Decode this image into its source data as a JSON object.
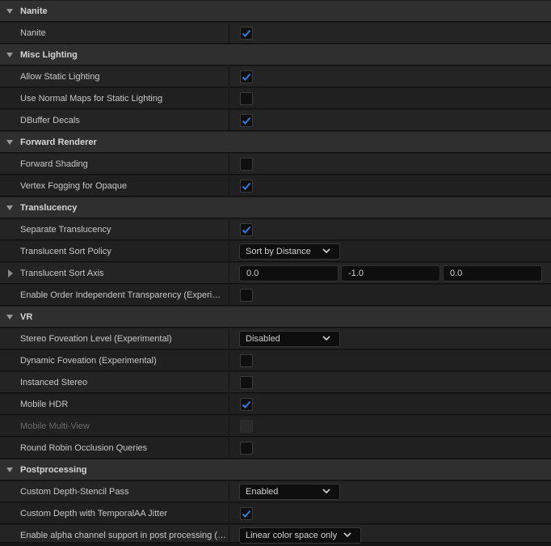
{
  "categories": {
    "nanite": "Nanite",
    "misc_lighting": "Misc Lighting",
    "forward_renderer": "Forward Renderer",
    "translucency": "Translucency",
    "vr": "VR",
    "postprocessing": "Postprocessing"
  },
  "properties": {
    "nanite": {
      "label": "Nanite",
      "checked": true
    },
    "allow_static_lighting": {
      "label": "Allow Static Lighting",
      "checked": true
    },
    "use_normal_maps_static_lighting": {
      "label": "Use Normal Maps for Static Lighting",
      "checked": false
    },
    "dbuffer_decals": {
      "label": "DBuffer Decals",
      "checked": true
    },
    "forward_shading": {
      "label": "Forward Shading",
      "checked": false
    },
    "vertex_fogging_opaque": {
      "label": "Vertex Fogging for Opaque",
      "checked": true
    },
    "separate_translucency": {
      "label": "Separate Translucency",
      "checked": true
    },
    "translucent_sort_policy": {
      "label": "Translucent Sort Policy",
      "value": "Sort by Distance"
    },
    "translucent_sort_axis": {
      "label": "Translucent Sort Axis",
      "x": "0.0",
      "y": "-1.0",
      "z": "0.0"
    },
    "order_independent_transparency": {
      "label": "Enable Order Independent Transparency (Experimental)",
      "checked": false
    },
    "stereo_foveation_level": {
      "label": "Stereo Foveation Level (Experimental)",
      "value": "Disabled"
    },
    "dynamic_foveation": {
      "label": "Dynamic Foveation (Experimental)",
      "checked": false
    },
    "instanced_stereo": {
      "label": "Instanced Stereo",
      "checked": false
    },
    "mobile_hdr": {
      "label": "Mobile HDR",
      "checked": true
    },
    "mobile_multi_view": {
      "label": "Mobile Multi-View",
      "checked": false,
      "disabled": true
    },
    "round_robin_occlusion": {
      "label": "Round Robin Occlusion Queries",
      "checked": false
    },
    "custom_depth_stencil_pass": {
      "label": "Custom Depth-Stencil Pass",
      "value": "Enabled"
    },
    "custom_depth_temporal_aa_jitter": {
      "label": "Custom Depth with TemporalAA Jitter",
      "checked": true
    },
    "alpha_channel_post_processing": {
      "label": "Enable alpha channel support in post processing (experimental)",
      "value": "Linear color space only"
    }
  },
  "icons": {
    "collapse": "caret-down-icon",
    "expand": "caret-right-icon",
    "check": "checkmark-icon",
    "dropdown": "chevron-down-icon"
  },
  "colors": {
    "check_accent": "#2f7bd8",
    "panel_bg": "#242424",
    "category_bg": "#2f2f2f"
  }
}
